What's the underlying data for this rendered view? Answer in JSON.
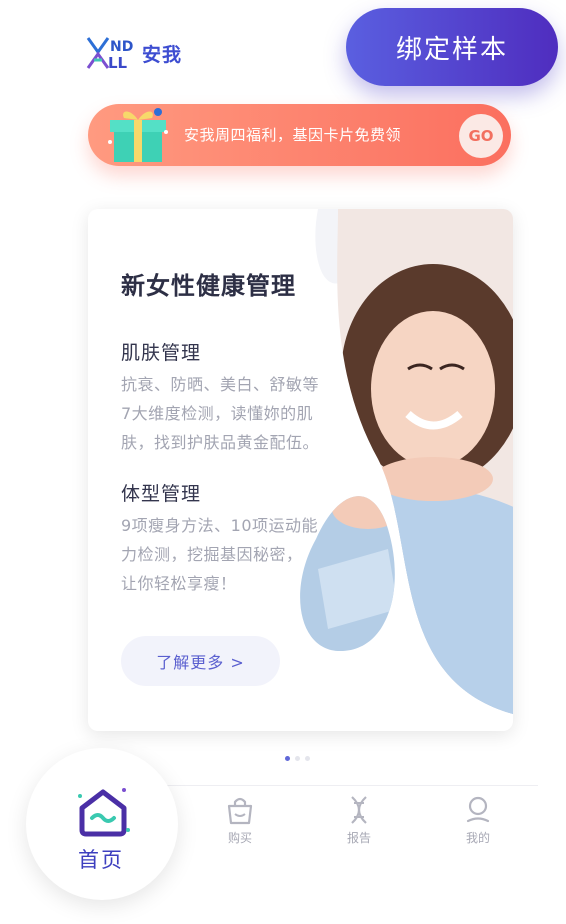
{
  "brand": {
    "logo_text": "安我"
  },
  "header": {
    "bind_sample_label": "绑定样本"
  },
  "promo": {
    "text": "安我周四福利，基因卡片免费领",
    "go_label": "GO"
  },
  "card": {
    "title": "新女性健康管理",
    "sections": [
      {
        "heading": "肌肤管理",
        "lines": [
          "抗衰、防晒、美白、舒敏等",
          "7大维度检测，读懂妳的肌",
          "肤，找到护肤品黄金配伍。"
        ]
      },
      {
        "heading": "体型管理",
        "lines": [
          "9项瘦身方法、10项运动能",
          "力检测，挖掘基因秘密，",
          "让你轻松享瘦！"
        ]
      }
    ],
    "learn_more_label": "了解更多 >"
  },
  "pager": {
    "count": 3,
    "active_index": 0
  },
  "nav": {
    "items": [
      {
        "label": "首页",
        "icon": "home-icon",
        "active": true
      },
      {
        "label": "购买",
        "icon": "shopping-bag-icon",
        "active": false
      },
      {
        "label": "报告",
        "icon": "dna-icon",
        "active": false
      },
      {
        "label": "我的",
        "icon": "user-icon",
        "active": false
      }
    ]
  },
  "colors": {
    "brand_blue": "#3d4dd1",
    "bind_button_start": "#5a5fe0",
    "bind_button_end": "#4f2dbf",
    "promo_start": "#ff9a80",
    "promo_end": "#fb6f5f",
    "nav_active": "#3d3fbf",
    "nav_inactive": "#a7a8b4"
  }
}
